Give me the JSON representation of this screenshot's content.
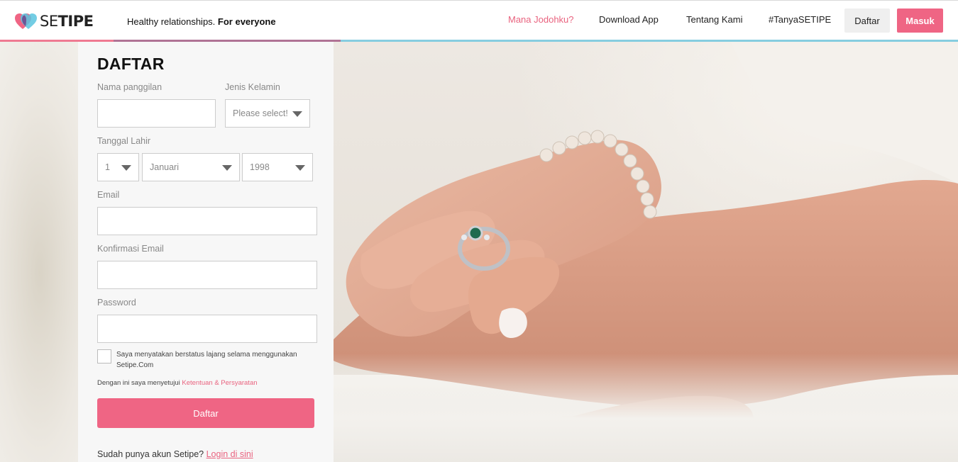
{
  "brand": {
    "logo_se": "SE",
    "logo_tipe": "TIPE",
    "tagline_normal": "Healthy relationships.",
    "tagline_bold": "For everyone"
  },
  "nav": {
    "items": [
      {
        "label": "Mana Jodohku?"
      },
      {
        "label": "Download App"
      },
      {
        "label": "Tentang Kami"
      },
      {
        "label": "#TanyaSETIPE"
      }
    ],
    "daftar_label": "Daftar",
    "masuk_label": "Masuk"
  },
  "form": {
    "title": "DAFTAR",
    "nickname_label": "Nama panggilan",
    "nickname_value": "",
    "gender_label": "Jenis Kelamin",
    "gender_selected": "Please select!",
    "birthdate_label": "Tanggal Lahir",
    "birth_day": "1",
    "birth_month": "Januari",
    "birth_year": "1998",
    "email_label": "Email",
    "email_value": "",
    "confirm_email_label": "Konfirmasi Email",
    "confirm_email_value": "",
    "password_label": "Password",
    "password_value": "",
    "single_statement": "Saya menyatakan berstatus lajang selama menggunakan Setipe.Com",
    "agree_prefix": "Dengan ini saya menyetujui",
    "agree_link": "Ketentuan & Persyaratan",
    "submit_label": "Daftar",
    "login_prompt": "Sudah punya akun Setipe?",
    "login_link": "Login di sini"
  },
  "colors": {
    "accent": "#ef6584",
    "accent_text": "#e9637f",
    "stripe_blue": "#86cde0",
    "stripe_purple": "#b07395"
  },
  "hero": {
    "image_subject": "hands-with-engagement-ring"
  }
}
